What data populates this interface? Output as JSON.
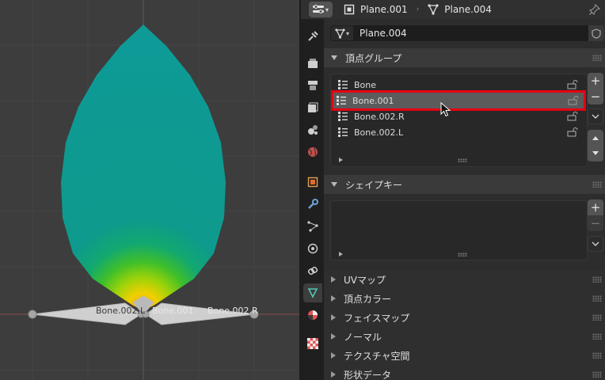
{
  "header": {
    "object_name": "Plane.001",
    "mesh_name": "Plane.004"
  },
  "datablock": {
    "name": "Plane.004"
  },
  "viewport": {
    "bone_labels": [
      "Bone.002.L",
      "Bone.001",
      "Bone.002.R"
    ]
  },
  "vertex_groups": {
    "title": "頂点グループ",
    "items": [
      {
        "label": "Bone"
      },
      {
        "label": "Bone.001"
      },
      {
        "label": "Bone.002.R"
      },
      {
        "label": "Bone.002.L"
      }
    ],
    "selected_index": 1,
    "add_label": "+",
    "remove_label": "−"
  },
  "shape_keys": {
    "title": "シェイプキー",
    "add_label": "+",
    "remove_label": "−"
  },
  "collapsed_panels": [
    {
      "label": "UVマップ"
    },
    {
      "label": "頂点カラー"
    },
    {
      "label": "フェイスマップ"
    },
    {
      "label": "ノーマル"
    },
    {
      "label": "テクスチャ空間"
    },
    {
      "label": "形状データ"
    }
  ],
  "tabs": [
    {
      "name": "tool",
      "icon": "tool-icon"
    },
    {
      "name": "render",
      "icon": "render-icon"
    },
    {
      "name": "output",
      "icon": "output-icon"
    },
    {
      "name": "view-layer",
      "icon": "view-layer-icon"
    },
    {
      "name": "scene",
      "icon": "scene-icon"
    },
    {
      "name": "world",
      "icon": "world-icon"
    },
    {
      "name": "object",
      "icon": "object-icon"
    },
    {
      "name": "modifiers",
      "icon": "wrench-icon"
    },
    {
      "name": "particles",
      "icon": "particles-icon"
    },
    {
      "name": "physics",
      "icon": "physics-icon"
    },
    {
      "name": "constraints",
      "icon": "constraints-icon"
    },
    {
      "name": "object-data",
      "icon": "mesh-data-icon",
      "active": true
    },
    {
      "name": "material",
      "icon": "material-icon"
    },
    {
      "name": "texture",
      "icon": "texture-icon"
    }
  ],
  "colors": {
    "selection_highlight": "#e60012",
    "mesh_cyan": "#0e9a96",
    "mesh_yellow": "#f0c000",
    "bone_gray": "#cfcfcf"
  }
}
